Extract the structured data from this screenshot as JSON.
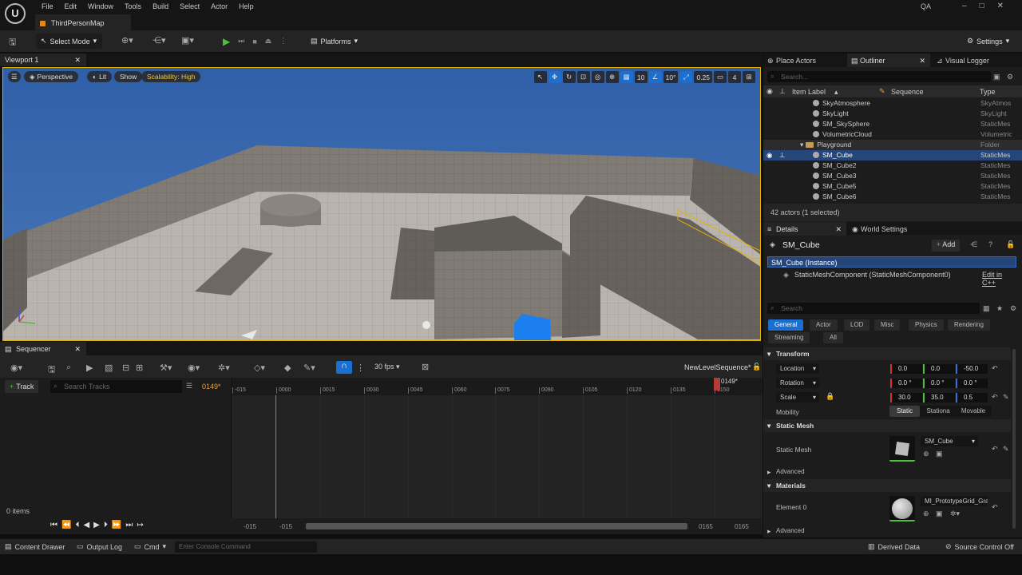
{
  "menubar": {
    "items": [
      "File",
      "Edit",
      "Window",
      "Tools",
      "Build",
      "Select",
      "Actor",
      "Help"
    ],
    "user": "QA",
    "window_controls": [
      "–",
      "□",
      "✕"
    ]
  },
  "tab": {
    "map_name": "ThirdPersonMap"
  },
  "toolbar": {
    "select_mode": "Select Mode",
    "platforms": "Platforms",
    "settings": "Settings"
  },
  "viewport": {
    "tab_label": "Viewport 1",
    "perspective": "Perspective",
    "lit": "Lit",
    "show": "Show",
    "scalability": "Scalability: High",
    "grid_snap": "10",
    "rot_snap": "10°",
    "scale_snap": "0.25",
    "camera_speed": "4"
  },
  "sequencer": {
    "tab_label": "Sequencer",
    "fps": "30 fps",
    "sequence_name": "NewLevelSequence*",
    "add_track": "Track",
    "search_placeholder": "Search Tracks",
    "current_time": "0149*",
    "playhead_time": "0149*",
    "items_count": "0 items",
    "ruler_ticks": [
      "-015",
      "0000",
      "0015",
      "0030",
      "0045",
      "0060",
      "0075",
      "0090",
      "0105",
      "0120",
      "0135",
      "0150"
    ],
    "range_start_outer": "-015",
    "range_start_inner": "-015",
    "range_end_inner": "0165",
    "range_end_outer": "0165"
  },
  "status": {
    "content_drawer": "Content Drawer",
    "output_log": "Output Log",
    "cmd": "Cmd",
    "console_placeholder": "Enter Console Command",
    "derived_data": "Derived Data",
    "source_control": "Source Control Off"
  },
  "outliner": {
    "tabs": [
      "Place Actors",
      "Outliner",
      "Visual Logger"
    ],
    "search_placeholder": "Search...",
    "columns": [
      "Item Label",
      "Sequence",
      "Type"
    ],
    "rows": [
      {
        "label": "SkyAtmosphere",
        "type": "SkyAtmos"
      },
      {
        "label": "SkyLight",
        "type": "SkyLight"
      },
      {
        "label": "SM_SkySphere",
        "type": "StaticMes"
      },
      {
        "label": "VolumetricCloud",
        "type": "Volumetric"
      },
      {
        "label": "Playground",
        "type": "Folder"
      },
      {
        "label": "SM_Cube",
        "type": "StaticMes"
      },
      {
        "label": "SM_Cube2",
        "type": "StaticMes"
      },
      {
        "label": "SM_Cube3",
        "type": "StaticMes"
      },
      {
        "label": "SM_Cube5",
        "type": "StaticMes"
      },
      {
        "label": "SM_Cube6",
        "type": "StaticMes"
      }
    ],
    "footer": "42 actors (1 selected)"
  },
  "details": {
    "tabs": [
      "Details",
      "World Settings"
    ],
    "object_name": "SM_Cube",
    "add_label": "Add",
    "instance_label": "SM_Cube (Instance)",
    "component_label": "StaticMeshComponent (StaticMeshComponent0)",
    "edit_cpp": "Edit in C++",
    "search_placeholder": "Search",
    "filter_tabs": [
      "General",
      "Actor",
      "LOD",
      "Misc",
      "Physics",
      "Rendering",
      "Streaming",
      "All"
    ],
    "transform": {
      "section": "Transform",
      "location_label": "Location",
      "location": [
        "0.0",
        "0.0",
        "-50.0"
      ],
      "rotation_label": "Rotation",
      "rotation": [
        "0.0 °",
        "0.0 °",
        "0.0 °"
      ],
      "scale_label": "Scale",
      "scale": [
        "30.0",
        "35.0",
        "0.5"
      ],
      "mobility_label": "Mobility",
      "mobility_options": [
        "Static",
        "Stationa",
        "Movable"
      ]
    },
    "static_mesh": {
      "section": "Static Mesh",
      "label": "Static Mesh",
      "value": "SM_Cube",
      "advanced": "Advanced"
    },
    "materials": {
      "section": "Materials",
      "element_label": "Element 0",
      "value": "MI_PrototypeGrid_Gray",
      "advanced": "Advanced"
    }
  },
  "colors": {
    "accent_blue": "#1a6fd1",
    "selection": "#26467a",
    "play_green": "#4fbf3e",
    "viewport_border": "#e2b200",
    "sky_top": "#2f5fa8"
  }
}
